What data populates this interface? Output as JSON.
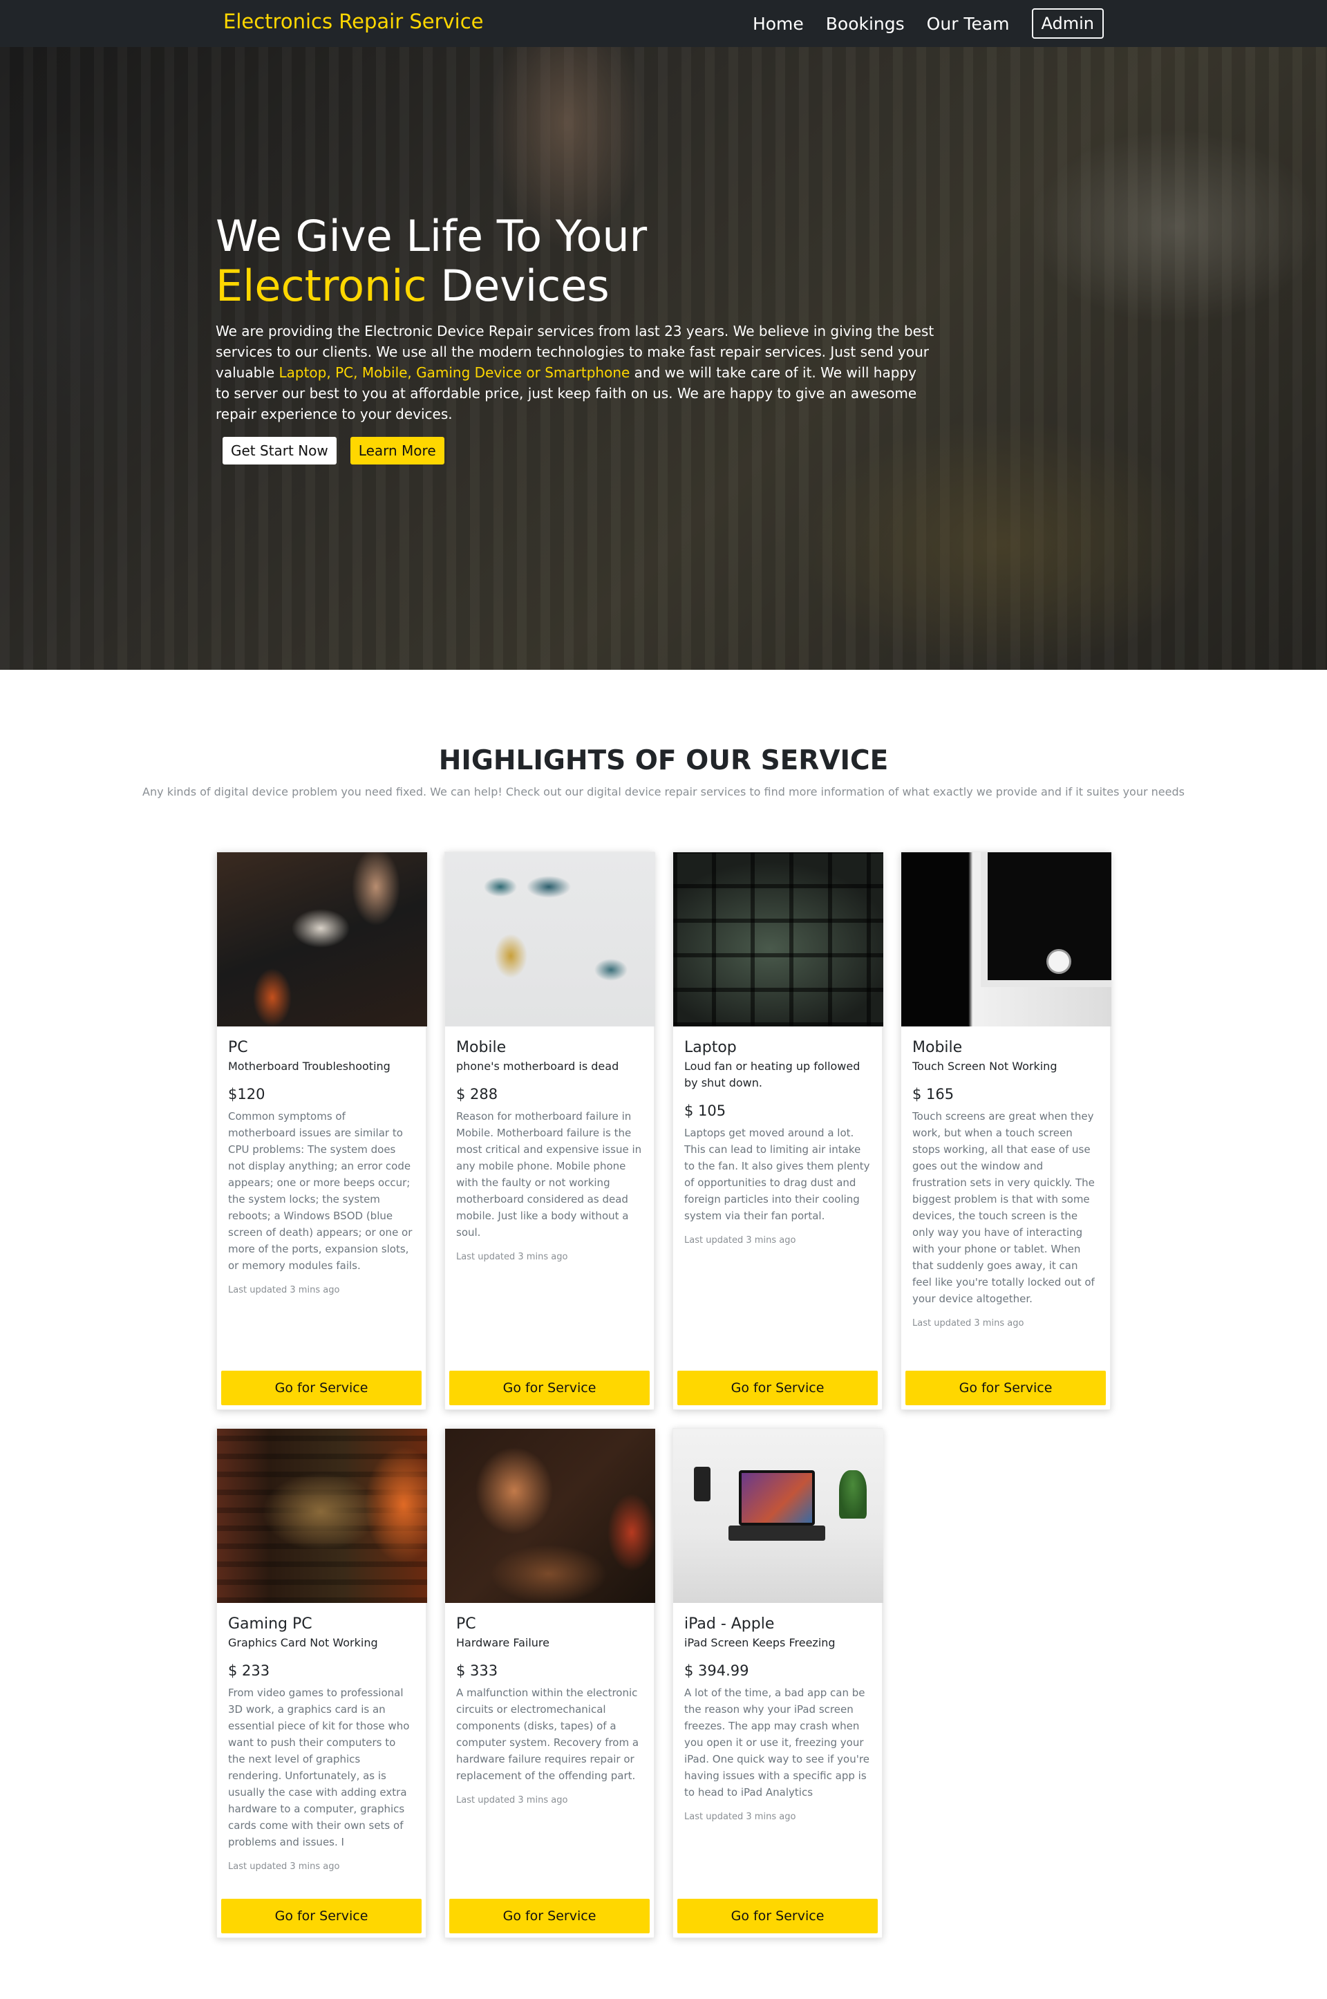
{
  "navbar": {
    "brand": "Electronics Repair Service",
    "links": [
      "Home",
      "Bookings",
      "Our Team"
    ],
    "admin": "Admin"
  },
  "hero": {
    "title_line1": "We Give Life To Your",
    "title_accent": "Electronic",
    "title_rest": " Devices",
    "text_part1": "We are providing the Electronic Device Repair services from last 23 years. We believe in giving the best services to our clients. We use all the modern technologies to make fast repair services. Just send your valuable ",
    "text_highlight": "Laptop, PC, Mobile, Gaming Device or Smartphone",
    "text_part2": " and we will take care of it. We will happy to server our best to you at affordable price, just keep faith on us. We are happy to give an awesome repair experience to your devices.",
    "btn_start": "Get Start Now",
    "btn_learn": "Learn More"
  },
  "highlights": {
    "title": "HIGHLIGHTS OF OUR SERVICE",
    "subtitle": "Any kinds of digital device problem you need fixed. We can help! Check out our digital device repair services to find more information of what exactly we provide and if it suites your needs"
  },
  "cards": [
    {
      "title": "PC",
      "subtitle": "Motherboard Troubleshooting",
      "price": "$120",
      "description": "Common symptoms of motherboard issues are similar to CPU problems: The system does not display anything; an error code appears; one or more beeps occur; the system locks; the system reboots; a Windows BSOD (blue screen of death) appears; or one or more of the ports, expansion slots, or memory modules fails.",
      "updated": "Last updated 3 mins ago",
      "button": "Go for Service"
    },
    {
      "title": "Mobile",
      "subtitle": "phone's motherboard is dead",
      "price": "$ 288",
      "description": "Reason for motherboard failure in Mobile. Motherboard failure is the most critical and expensive issue in any mobile phone. Mobile phone with the faulty or not working motherboard considered as dead mobile. Just like a body without a soul.",
      "updated": "Last updated 3 mins ago",
      "button": "Go for Service"
    },
    {
      "title": "Laptop",
      "subtitle": "Loud fan or heating up followed by shut down.",
      "price": "$ 105",
      "description": "Laptops get moved around a lot. This can lead to limiting air intake to the fan. It also gives them plenty of opportunities to drag dust and foreign particles into their cooling system via their fan portal.",
      "updated": "Last updated 3 mins ago",
      "button": "Go for Service"
    },
    {
      "title": "Mobile",
      "subtitle": "Touch Screen Not Working",
      "price": "$ 165",
      "description": "Touch screens are great when they work, but when a touch screen stops working, all that ease of use goes out the window and frustration sets in very quickly. The biggest problem is that with some devices, the touch screen is the only way you have of interacting with your phone or tablet. When that suddenly goes away, it can feel like you're totally locked out of your device altogether.",
      "updated": "Last updated 3 mins ago",
      "button": "Go for Service"
    },
    {
      "title": "Gaming PC",
      "subtitle": "Graphics Card Not Working",
      "price": "$ 233",
      "description": "From video games to professional 3D work, a graphics card is an essential piece of kit for those who want to push their computers to the next level of graphics rendering. Unfortunately, as is usually the case with adding extra hardware to a computer, graphics cards come with their own sets of problems and issues. I",
      "updated": "Last updated 3 mins ago",
      "button": "Go for Service"
    },
    {
      "title": "PC",
      "subtitle": "Hardware Failure",
      "price": "$ 333",
      "description": "A malfunction within the electronic circuits or electromechanical components (disks, tapes) of a computer system. Recovery from a hardware failure requires repair or replacement of the offending part.",
      "updated": "Last updated 3 mins ago",
      "button": "Go for Service"
    },
    {
      "title": "iPad - Apple",
      "subtitle": "iPad Screen Keeps Freezing",
      "price": "$ 394.99",
      "description": "A lot of the time, a bad app can be the reason why your iPad screen freezes. The app may crash when you open it or use it, freezing your iPad. One quick way to see if you're having issues with a specific app is to head to iPad Analytics",
      "updated": "Last updated 3 mins ago",
      "button": "Go for Service"
    }
  ]
}
